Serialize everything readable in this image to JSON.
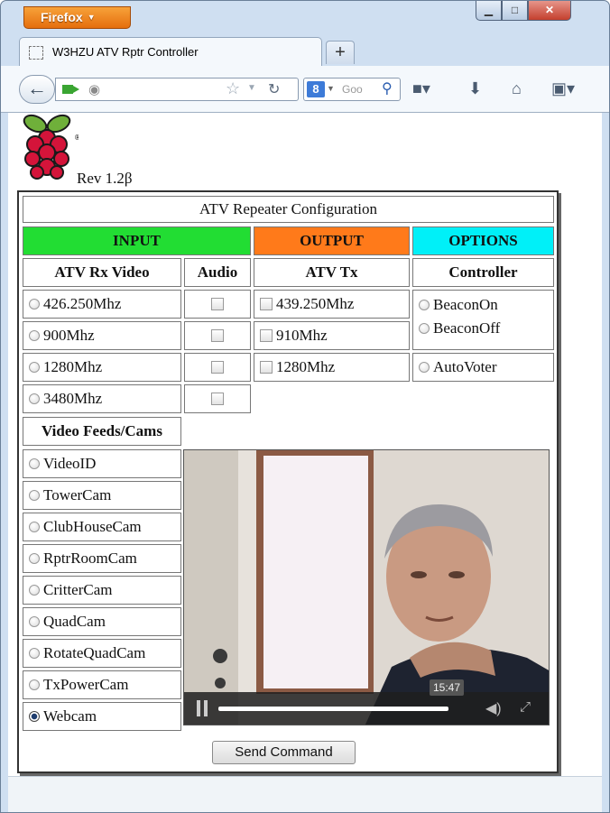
{
  "browser": {
    "menu_button": "Firefox",
    "window_controls": {
      "minimize": "▁",
      "maximize": "□",
      "close": "✕"
    },
    "tab_title": "W3HZU ATV Rptr Controller",
    "new_tab": "+",
    "search_placeholder": "Goo"
  },
  "page": {
    "revision": "Rev 1.2β",
    "table_title": "ATV Repeater Configuration",
    "sections": {
      "input": {
        "label": "INPUT",
        "color": "#22dd33"
      },
      "output": {
        "label": "OUTPUT",
        "color": "#ff7a1a"
      },
      "options": {
        "label": "OPTIONS",
        "color": "#00f0f8"
      }
    },
    "columns": {
      "rx_video": "ATV Rx Video",
      "audio": "Audio",
      "tx": "ATV Tx",
      "controller": "Controller"
    },
    "rx_options": [
      "426.250Mhz",
      "900Mhz",
      "1280Mhz",
      "3480Mhz"
    ],
    "tx_options": [
      "439.250Mhz",
      "910Mhz",
      "1280Mhz"
    ],
    "controller_options": [
      "BeaconOn",
      "BeaconOff",
      "AutoVoter"
    ],
    "feeds_header": "Video Feeds/Cams",
    "feeds": [
      "VideoID",
      "TowerCam",
      "ClubHouseCam",
      "RptrRoomCam",
      "CritterCam",
      "QuadCam",
      "RotateQuadCam",
      "TxPowerCam",
      "Webcam"
    ],
    "selected_feed": "Webcam",
    "video": {
      "time": "15:47",
      "progress": 0.86
    },
    "send_button": "Send Command"
  }
}
